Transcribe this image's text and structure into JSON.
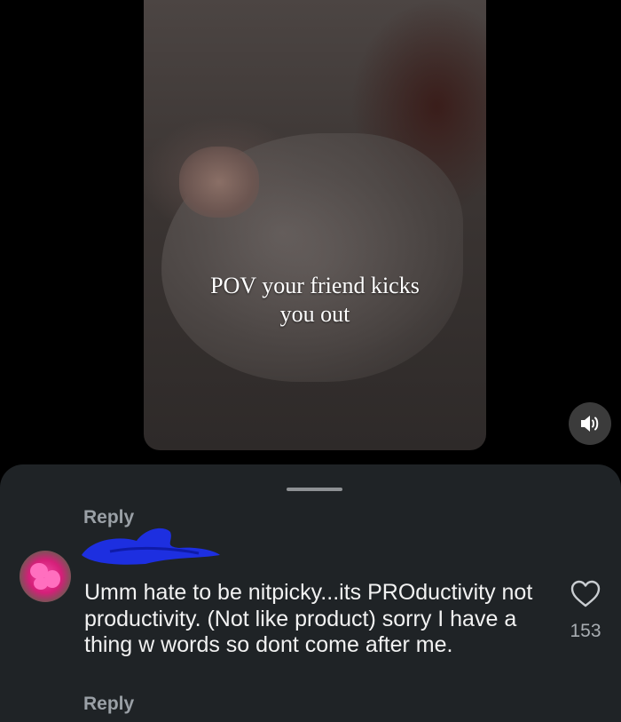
{
  "video": {
    "caption_line1": "POV your friend kicks",
    "caption_line2": "you out"
  },
  "controls": {
    "sound_icon": "speaker-on-icon"
  },
  "comments": {
    "reply_label_top": "Reply",
    "comment": {
      "text": "Umm hate to be nitpicky...its PROductivity not productivity. (Not like product)  sorry I have a thing w words so dont come after me.",
      "reply_label": "Reply",
      "like_icon": "heart-icon",
      "like_count": "153"
    }
  }
}
